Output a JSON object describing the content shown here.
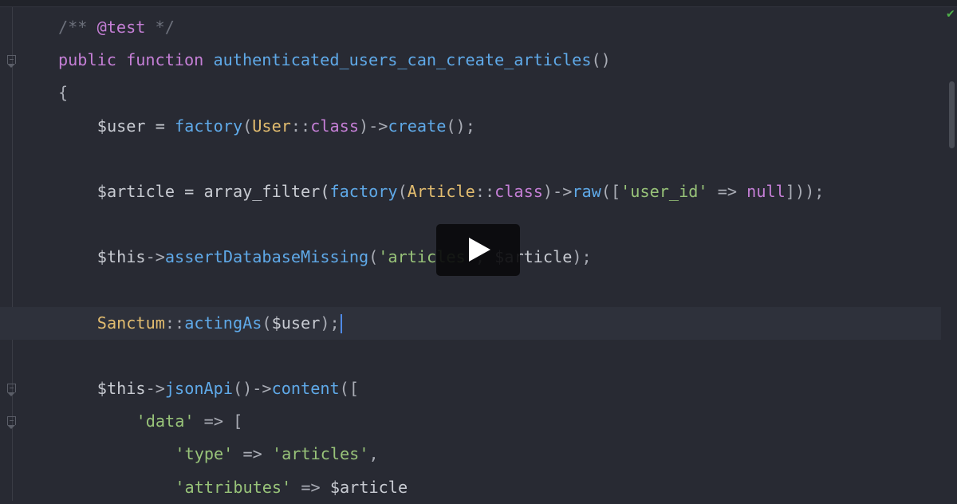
{
  "editor": {
    "status_icon": "check-icon",
    "lines": [
      {
        "indent": 0,
        "fold": false,
        "tokens": [
          [
            "comment",
            "/** "
          ],
          [
            "doc",
            "@test"
          ],
          [
            "comment",
            " */"
          ]
        ]
      },
      {
        "indent": 0,
        "fold": true,
        "tokens": [
          [
            "kw",
            "public"
          ],
          [
            "var",
            " "
          ],
          [
            "kw",
            "function"
          ],
          [
            "var",
            " "
          ],
          [
            "fn",
            "authenticated_users_can_create_articles"
          ],
          [
            "punc",
            "()"
          ]
        ]
      },
      {
        "indent": 0,
        "fold": false,
        "tokens": [
          [
            "punc",
            "{"
          ]
        ]
      },
      {
        "indent": 1,
        "fold": false,
        "tokens": [
          [
            "var",
            "$user = "
          ],
          [
            "fn",
            "factory"
          ],
          [
            "punc",
            "("
          ],
          [
            "cls",
            "User"
          ],
          [
            "punc",
            "::"
          ],
          [
            "kw",
            "class"
          ],
          [
            "punc",
            ")->"
          ],
          [
            "fn",
            "create"
          ],
          [
            "punc",
            "();"
          ]
        ]
      },
      {
        "indent": 0,
        "fold": false,
        "tokens": []
      },
      {
        "indent": 1,
        "fold": false,
        "tokens": [
          [
            "var",
            "$article = array_filter("
          ],
          [
            "fn",
            "factory"
          ],
          [
            "punc",
            "("
          ],
          [
            "cls",
            "Article"
          ],
          [
            "punc",
            "::"
          ],
          [
            "kw",
            "class"
          ],
          [
            "punc",
            ")->"
          ],
          [
            "fn",
            "raw"
          ],
          [
            "punc",
            "(["
          ],
          [
            "str",
            "'user_id'"
          ],
          [
            "punc",
            " => "
          ],
          [
            "kw",
            "null"
          ],
          [
            "punc",
            "]));"
          ]
        ]
      },
      {
        "indent": 0,
        "fold": false,
        "tokens": []
      },
      {
        "indent": 1,
        "fold": false,
        "tokens": [
          [
            "var",
            "$this"
          ],
          [
            "punc",
            "->"
          ],
          [
            "fn",
            "assertDatabaseMissing"
          ],
          [
            "punc",
            "("
          ],
          [
            "str",
            "'articles'"
          ],
          [
            "punc",
            ", "
          ],
          [
            "var",
            "$article"
          ],
          [
            "punc",
            ");"
          ]
        ]
      },
      {
        "indent": 0,
        "fold": false,
        "tokens": []
      },
      {
        "indent": 1,
        "fold": false,
        "current": true,
        "tokens": [
          [
            "cls",
            "Sanctum"
          ],
          [
            "punc",
            "::"
          ],
          [
            "fn",
            "actingAs"
          ],
          [
            "punc",
            "("
          ],
          [
            "var",
            "$user"
          ],
          [
            "punc",
            ");"
          ]
        ]
      },
      {
        "indent": 0,
        "fold": false,
        "tokens": []
      },
      {
        "indent": 1,
        "fold": true,
        "tokens": [
          [
            "var",
            "$this"
          ],
          [
            "punc",
            "->"
          ],
          [
            "fn",
            "jsonApi"
          ],
          [
            "punc",
            "()->"
          ],
          [
            "fn",
            "content"
          ],
          [
            "punc",
            "(["
          ]
        ]
      },
      {
        "indent": 2,
        "fold": true,
        "tokens": [
          [
            "str",
            "'data'"
          ],
          [
            "punc",
            " => ["
          ]
        ]
      },
      {
        "indent": 3,
        "fold": false,
        "tokens": [
          [
            "str",
            "'type'"
          ],
          [
            "punc",
            " => "
          ],
          [
            "str",
            "'articles'"
          ],
          [
            "punc",
            ","
          ]
        ]
      },
      {
        "indent": 3,
        "fold": false,
        "tokens": [
          [
            "str",
            "'attributes'"
          ],
          [
            "punc",
            " => "
          ],
          [
            "var",
            "$article"
          ]
        ]
      }
    ]
  },
  "video": {
    "play_icon": "play-icon"
  }
}
